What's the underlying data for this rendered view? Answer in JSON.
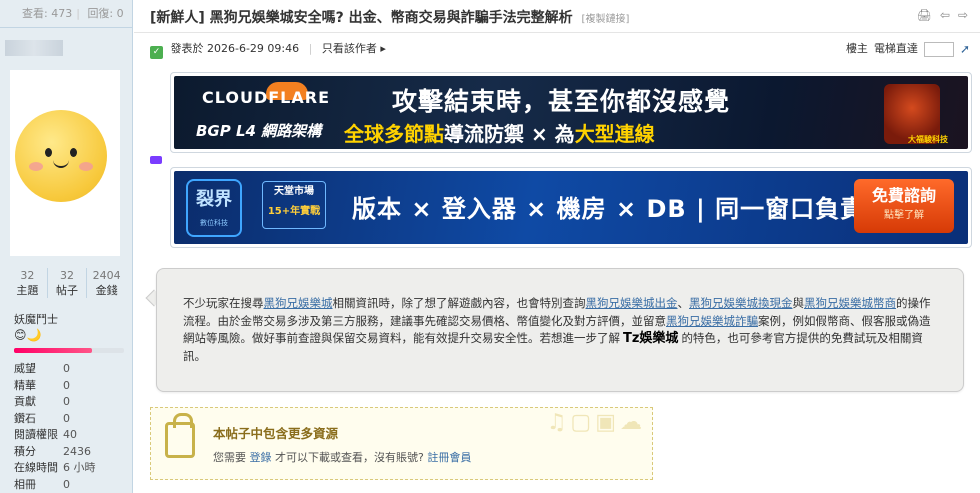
{
  "stats": {
    "views_label": "查看:",
    "views": "473",
    "replies_label": "回復:",
    "replies": "0"
  },
  "counts": [
    {
      "num": "32",
      "label": "主題"
    },
    {
      "num": "32",
      "label": "帖子"
    },
    {
      "num": "2404",
      "label": "金錢"
    }
  ],
  "group": "妖魔鬥士",
  "medals": "😊🌙",
  "level_fraction": 0.71,
  "profile": [
    {
      "k": "威望",
      "v": "0"
    },
    {
      "k": "精華",
      "v": "0"
    },
    {
      "k": "貢獻",
      "v": "0"
    },
    {
      "k": "鑽石",
      "v": "0"
    },
    {
      "k": "閱讀權限",
      "v": "40"
    },
    {
      "k": "積分",
      "v": "2436"
    },
    {
      "k": "在線時間",
      "v": "6 小時"
    },
    {
      "k": "相冊",
      "v": "0"
    }
  ],
  "thread": {
    "title": "[新鮮人] 黑狗兄娛樂城安全嗎? 出金、幣商交易與詐騙手法完整解析",
    "copy_link": "[複製鏈接]"
  },
  "tools": [
    "🖨",
    "⇦",
    "⇨"
  ],
  "post_info": {
    "posted": "發表於 2026-6-29 09:46",
    "only_author": "只看該作者",
    "floor": "樓主",
    "elevator": "電梯直達"
  },
  "banner1": {
    "logo": "CLOUDFLARE",
    "sub": "BGP L4 網路架構",
    "headline": "攻擊結束時，甚至你都沒感覺",
    "line_a": "全球多節點",
    "line_b": "導流防禦 × 為",
    "line_c": "大型連線",
    "brand": "大福駿科技"
  },
  "banner2": {
    "logo": "裂界",
    "logo_sub": "數位科技",
    "market": "天堂市場",
    "years": "15+年實戰",
    "main": "版本 × 登入器 × 機房 × DB | 同一窗口負責到底",
    "cta": "免費諮詢",
    "cta_sub": "點擊了解"
  },
  "quote": {
    "t1": "不少玩家在搜尋",
    "k1": "黑狗兄娛樂城",
    "t2": "相關資訊時，除了想了解遊戲內容，也會特別查詢",
    "k2": "黑狗兄娛樂城出金",
    "t3": "、",
    "k3": "黑狗兄娛樂城換現金",
    "t4": "與",
    "k4": "黑狗兄娛樂城幣商",
    "t5": "的操作流程。由於金幣交易多涉及第三方服務，建議事先確認交易價格、幣值變化及對方評價，並留意",
    "k5": "黑狗兄娛樂城詐騙",
    "t6": "案例，例如假幣商、假客服或偽造網站等風險。做好事前查證與保留交易資料，能有效提升交易安全性。若想進一步了解",
    "big": "Tz娛樂城",
    "t7": "的特色，也可參考官方提供的免費試玩及相關資訊。"
  },
  "locked": {
    "title": "本帖子中包含更多資源",
    "need": "您需要",
    "login": "登錄",
    "mid": "才可以下載或查看，沒有賬號?",
    "register": "註冊會員"
  },
  "colors": {
    "sidebar_bg": "#e5edf2",
    "link": "#3a6ea5",
    "level": "#ff0066"
  }
}
